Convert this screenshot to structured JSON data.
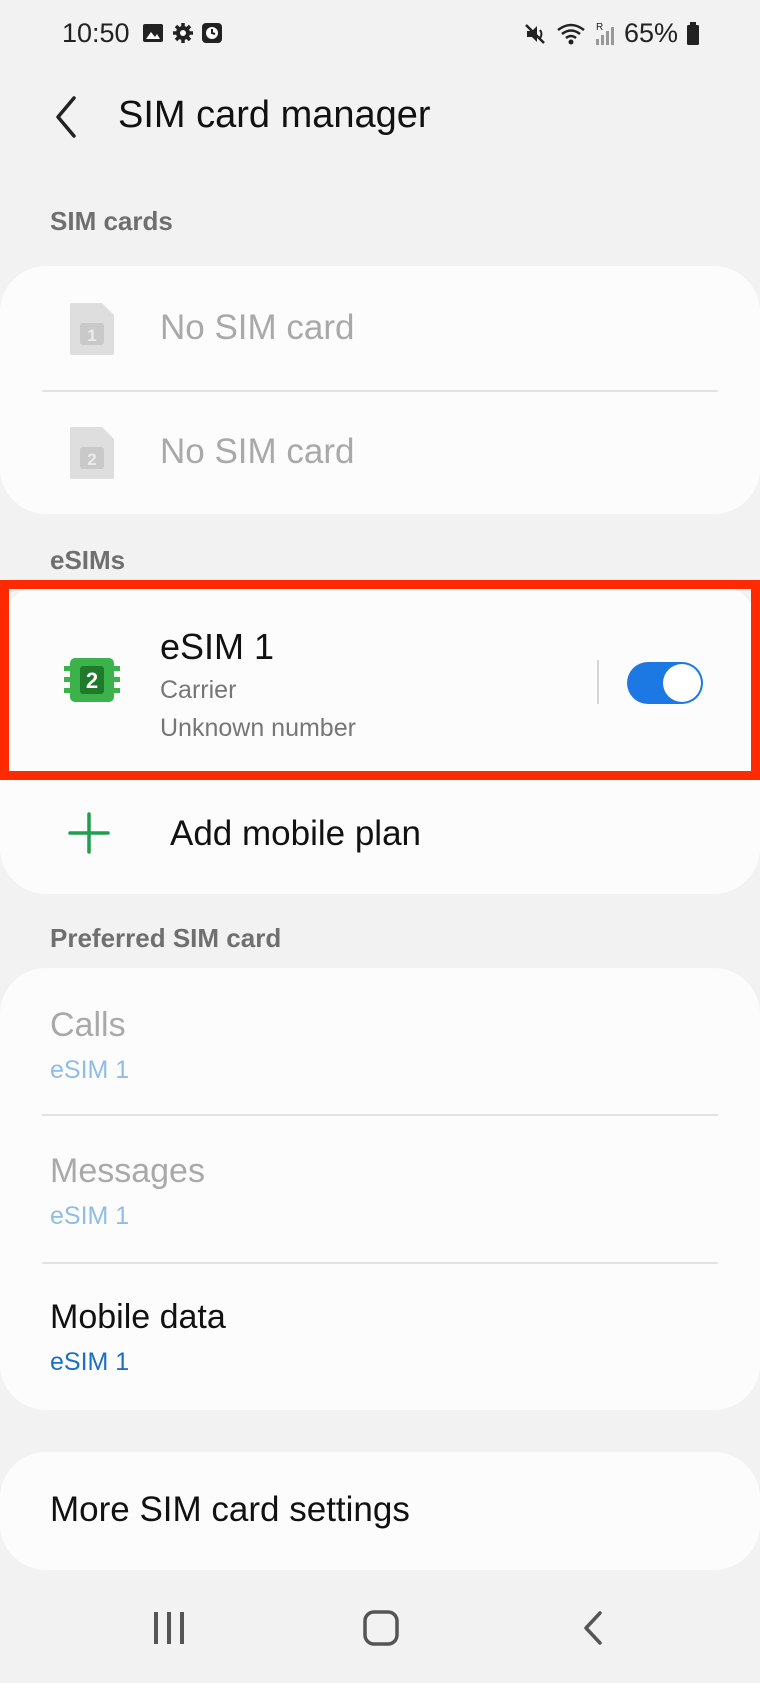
{
  "status": {
    "time": "10:50",
    "battery": "65%"
  },
  "header": {
    "title": "SIM card manager"
  },
  "sim_section": {
    "label": "SIM cards",
    "items": [
      {
        "slot": "1",
        "label": "No SIM card"
      },
      {
        "slot": "2",
        "label": "No SIM card"
      }
    ]
  },
  "esim_section": {
    "label": "eSIMs",
    "esim": {
      "slot": "2",
      "title": "eSIM 1",
      "carrier": "Carrier",
      "number": "Unknown number",
      "enabled": true
    },
    "add_plan_label": "Add mobile plan"
  },
  "preferred_section": {
    "label": "Preferred SIM card",
    "items": [
      {
        "title": "Calls",
        "value": "eSIM 1"
      },
      {
        "title": "Messages",
        "value": "eSIM 1"
      },
      {
        "title": "Mobile data",
        "value": "eSIM 1"
      }
    ]
  },
  "more_settings": "More SIM card settings",
  "colors": {
    "accent_blue": "#1c79e4",
    "esim_green": "#3cb34a",
    "plus_green": "#1e9e4f",
    "highlight_red": "#ff2a00"
  },
  "icons": [
    "gallery-icon",
    "gear-icon",
    "clock-icon",
    "mute-icon",
    "wifi-icon",
    "signal-icon",
    "battery-icon",
    "back-arrow-icon",
    "sim-card-icon",
    "esim-icon",
    "plus-icon",
    "recents-nav-icon",
    "home-nav-icon",
    "back-nav-icon"
  ]
}
